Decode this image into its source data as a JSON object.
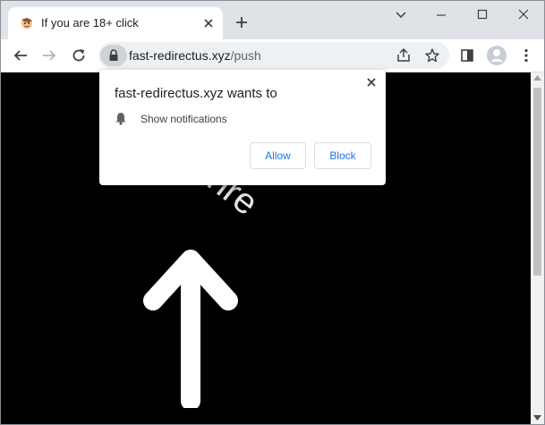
{
  "tab": {
    "title": "If you are 18+ click",
    "favicon": "cartoon-favicon-icon"
  },
  "address_bar": {
    "domain": "fast-redirectus.xyz",
    "path": "/push"
  },
  "popup": {
    "title": "fast-redirectus.xyz wants to",
    "permission_label": "Show notifications",
    "allow_label": "Allow",
    "block_label": "Block"
  },
  "page": {
    "watermark": "freegrunre"
  },
  "colors": {
    "accent": "#1a73e8",
    "content_bg": "#000000",
    "tabstrip_bg": "#dfe3e8"
  }
}
